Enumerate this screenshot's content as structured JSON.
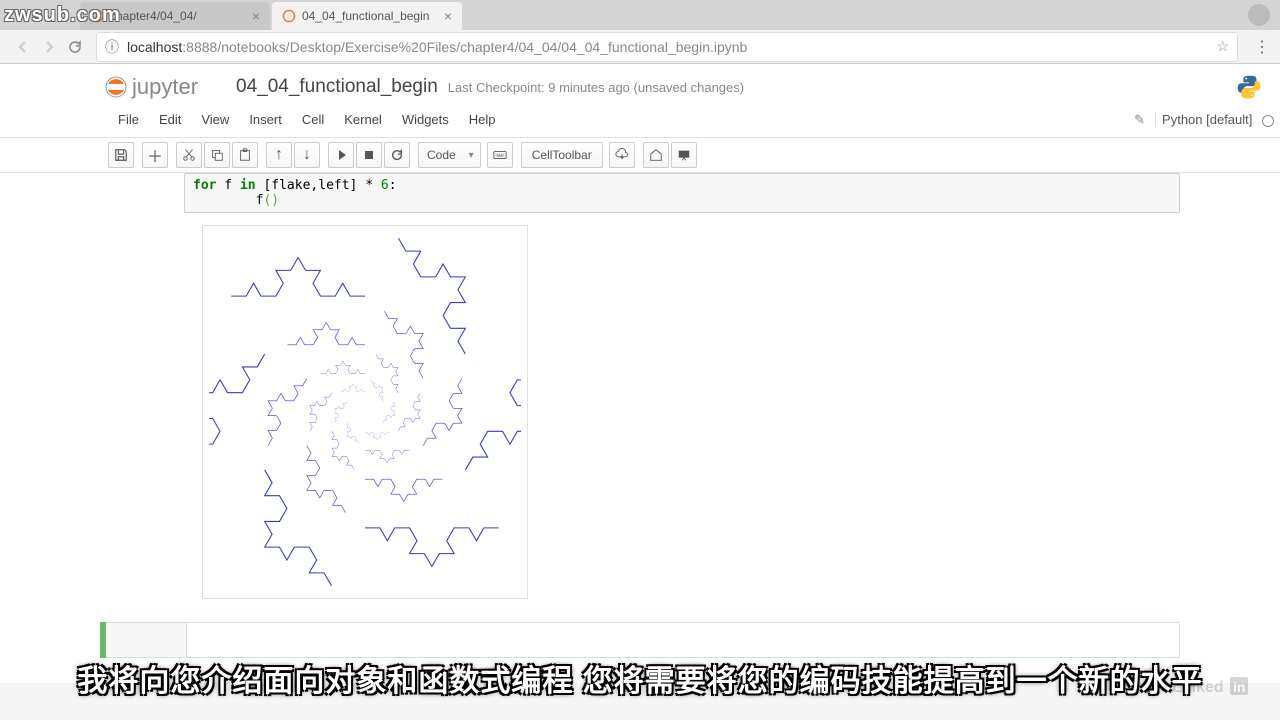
{
  "watermark": "zwsub.com",
  "browser": {
    "tabs": [
      {
        "title": "chapter4/04_04/",
        "active": false
      },
      {
        "title": "04_04_functional_begin",
        "active": true
      }
    ],
    "url_host": "localhost",
    "url_port": ":8888",
    "url_path": "/notebooks/Desktop/Exercise%20Files/chapter4/04_04/04_04_functional_begin.ipynb"
  },
  "jupyter": {
    "brand": "jupyter",
    "notebook_name": "04_04_functional_begin",
    "checkpoint": "Last Checkpoint: 9 minutes ago",
    "unsaved": "(unsaved changes)",
    "kernel_name": "Python [default]"
  },
  "menus": {
    "items": [
      "File",
      "Edit",
      "View",
      "Insert",
      "Cell",
      "Kernel",
      "Widgets",
      "Help"
    ]
  },
  "toolbar": {
    "celltype": "Code",
    "celltoolbar": "CellToolbar"
  },
  "code": {
    "line1_pre": "for",
    "line1_mid": " f ",
    "line1_in": "in",
    "line1_rest": " [flake,left] * ",
    "line1_num": "6",
    "line1_end": ":",
    "line2": "        f",
    "line2_paren": "()"
  },
  "subtitle": "我将向您介绍面向对象和函数式编程 您将需要将您的编码技能提高到一个新的水平"
}
